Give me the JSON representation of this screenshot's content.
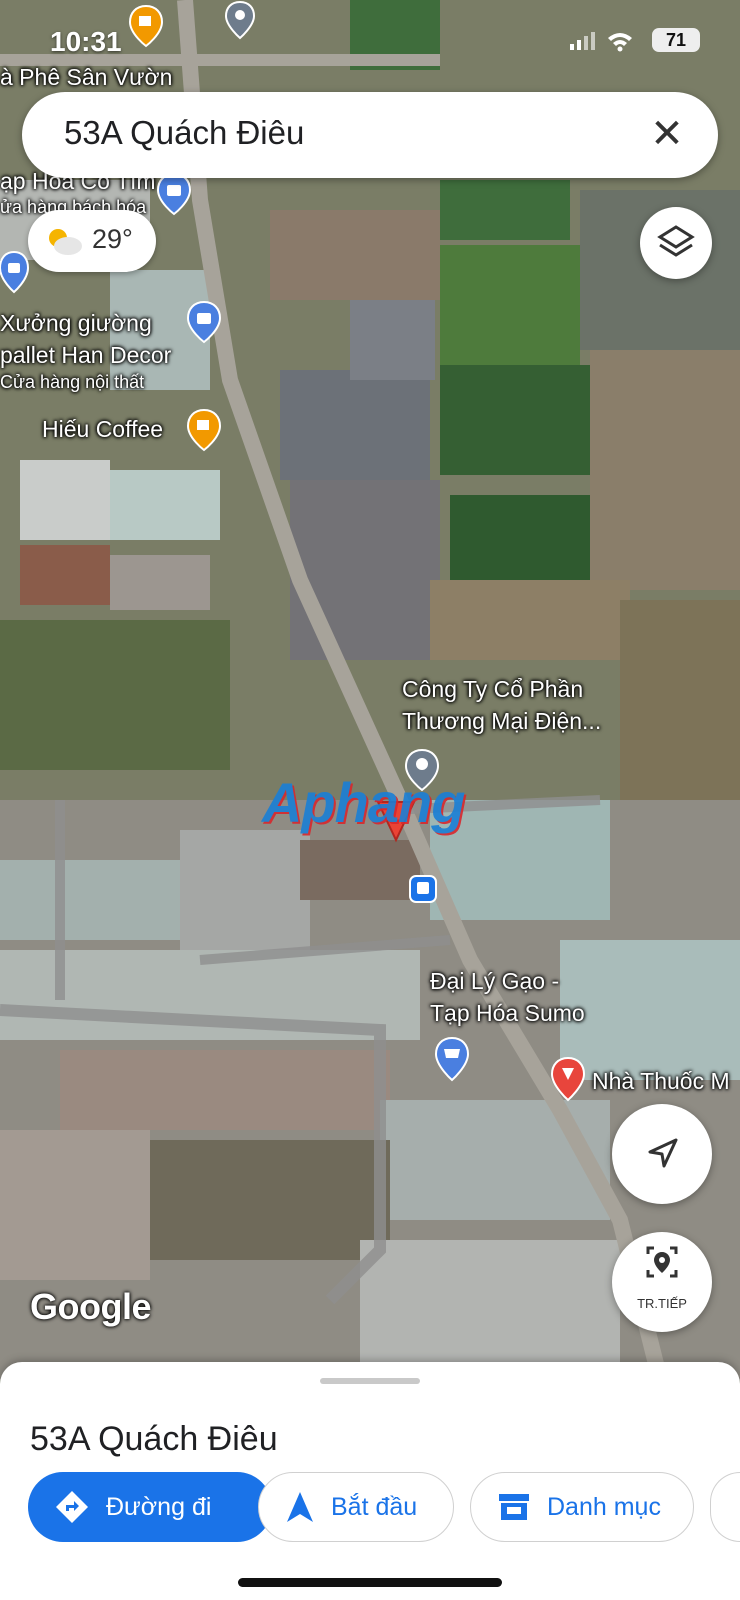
{
  "status": {
    "time": "10:31",
    "battery": "71"
  },
  "search": {
    "query": "53A Quách Điêu"
  },
  "weather": {
    "temp": "29°",
    "icon": "partly-cloudy-icon"
  },
  "map": {
    "labels": {
      "cafe_top": "à Phê Sân Vườn",
      "shop1_name": "ạp Hóa Cô Tím",
      "shop1_sub": "ửa hàng bách hóa",
      "furniture_name1": "Xưởng giường",
      "furniture_name2": "pallet Han Decor",
      "furniture_sub": "Cửa hàng nội thất",
      "coffee": "Hiếu Coffee",
      "company1": "Công Ty Cổ Phần",
      "company2": "Thương Mại Điện...",
      "rice1": "Đại Lý Gạo -",
      "rice2": "Tạp Hóa Sumo",
      "pharmacy": "Nhà Thuốc M"
    },
    "attribution": "Google",
    "watermark": "Aphang"
  },
  "controls": {
    "streetview_label": "TR.TIẾP"
  },
  "sheet": {
    "title": "53A Quách Điêu",
    "chips": {
      "directions": "Đường đi",
      "start": "Bắt đầu",
      "categories": "Danh mục"
    }
  },
  "colors": {
    "accent": "#1a73e8",
    "pin_red": "#ea4335",
    "cafe_orange": "#f29900"
  }
}
